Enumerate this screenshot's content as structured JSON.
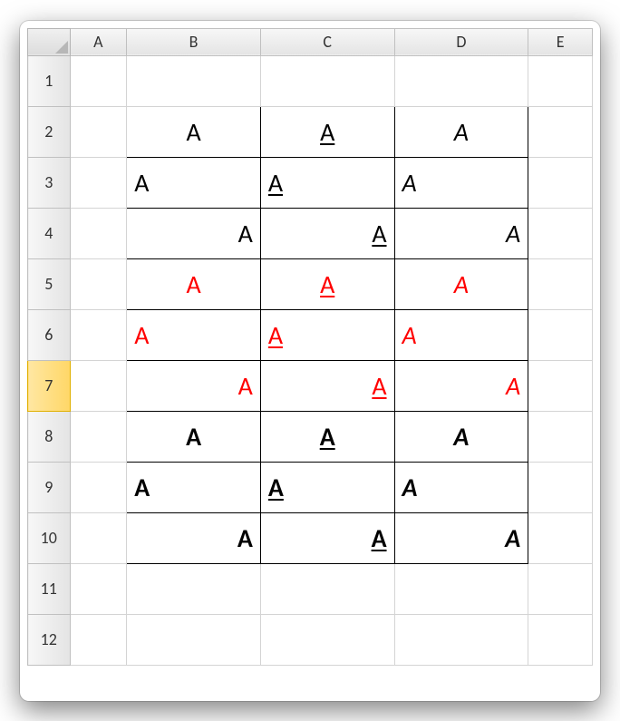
{
  "columns": [
    "A",
    "B",
    "C",
    "D",
    "E"
  ],
  "rowNumbers": [
    "1",
    "2",
    "3",
    "4",
    "5",
    "6",
    "7",
    "8",
    "9",
    "10",
    "11",
    "12"
  ],
  "activeRow": 7,
  "colors": {
    "red": "#ff0000",
    "black": "#000000"
  },
  "cells": {
    "B2": {
      "v": "A",
      "align": "center",
      "bold": false,
      "italic": false,
      "underline": false,
      "color": "black"
    },
    "C2": {
      "v": "A",
      "align": "center",
      "bold": false,
      "italic": false,
      "underline": true,
      "color": "black"
    },
    "D2": {
      "v": "A",
      "align": "center",
      "bold": false,
      "italic": true,
      "underline": false,
      "color": "black"
    },
    "B3": {
      "v": "A",
      "align": "left",
      "bold": false,
      "italic": false,
      "underline": false,
      "color": "black"
    },
    "C3": {
      "v": "A",
      "align": "left",
      "bold": false,
      "italic": false,
      "underline": true,
      "color": "black"
    },
    "D3": {
      "v": "A",
      "align": "left",
      "bold": false,
      "italic": true,
      "underline": false,
      "color": "black"
    },
    "B4": {
      "v": "A",
      "align": "right",
      "bold": false,
      "italic": false,
      "underline": false,
      "color": "black"
    },
    "C4": {
      "v": "A",
      "align": "right",
      "bold": false,
      "italic": false,
      "underline": true,
      "color": "black"
    },
    "D4": {
      "v": "A",
      "align": "right",
      "bold": false,
      "italic": true,
      "underline": false,
      "color": "black"
    },
    "B5": {
      "v": "A",
      "align": "center",
      "bold": false,
      "italic": false,
      "underline": false,
      "color": "red"
    },
    "C5": {
      "v": "A",
      "align": "center",
      "bold": false,
      "italic": false,
      "underline": true,
      "color": "red"
    },
    "D5": {
      "v": "A",
      "align": "center",
      "bold": false,
      "italic": true,
      "underline": false,
      "color": "red"
    },
    "B6": {
      "v": "A",
      "align": "left",
      "bold": false,
      "italic": false,
      "underline": false,
      "color": "red"
    },
    "C6": {
      "v": "A",
      "align": "left",
      "bold": false,
      "italic": false,
      "underline": true,
      "color": "red"
    },
    "D6": {
      "v": "A",
      "align": "left",
      "bold": false,
      "italic": true,
      "underline": false,
      "color": "red"
    },
    "B7": {
      "v": "A",
      "align": "right",
      "bold": false,
      "italic": false,
      "underline": false,
      "color": "red"
    },
    "C7": {
      "v": "A",
      "align": "right",
      "bold": false,
      "italic": false,
      "underline": true,
      "color": "red"
    },
    "D7": {
      "v": "A",
      "align": "right",
      "bold": false,
      "italic": true,
      "underline": false,
      "color": "red"
    },
    "B8": {
      "v": "A",
      "align": "center",
      "bold": true,
      "italic": false,
      "underline": false,
      "color": "black"
    },
    "C8": {
      "v": "A",
      "align": "center",
      "bold": true,
      "italic": false,
      "underline": true,
      "color": "black"
    },
    "D8": {
      "v": "A",
      "align": "center",
      "bold": true,
      "italic": true,
      "underline": false,
      "color": "black"
    },
    "B9": {
      "v": "A",
      "align": "left",
      "bold": true,
      "italic": false,
      "underline": false,
      "color": "black"
    },
    "C9": {
      "v": "A",
      "align": "left",
      "bold": true,
      "italic": false,
      "underline": true,
      "color": "black"
    },
    "D9": {
      "v": "A",
      "align": "left",
      "bold": true,
      "italic": true,
      "underline": false,
      "color": "black"
    },
    "B10": {
      "v": "A",
      "align": "right",
      "bold": true,
      "italic": false,
      "underline": false,
      "color": "black"
    },
    "C10": {
      "v": "A",
      "align": "right",
      "bold": true,
      "italic": false,
      "underline": true,
      "color": "black"
    },
    "D10": {
      "v": "A",
      "align": "right",
      "bold": true,
      "italic": true,
      "underline": false,
      "color": "black"
    }
  }
}
